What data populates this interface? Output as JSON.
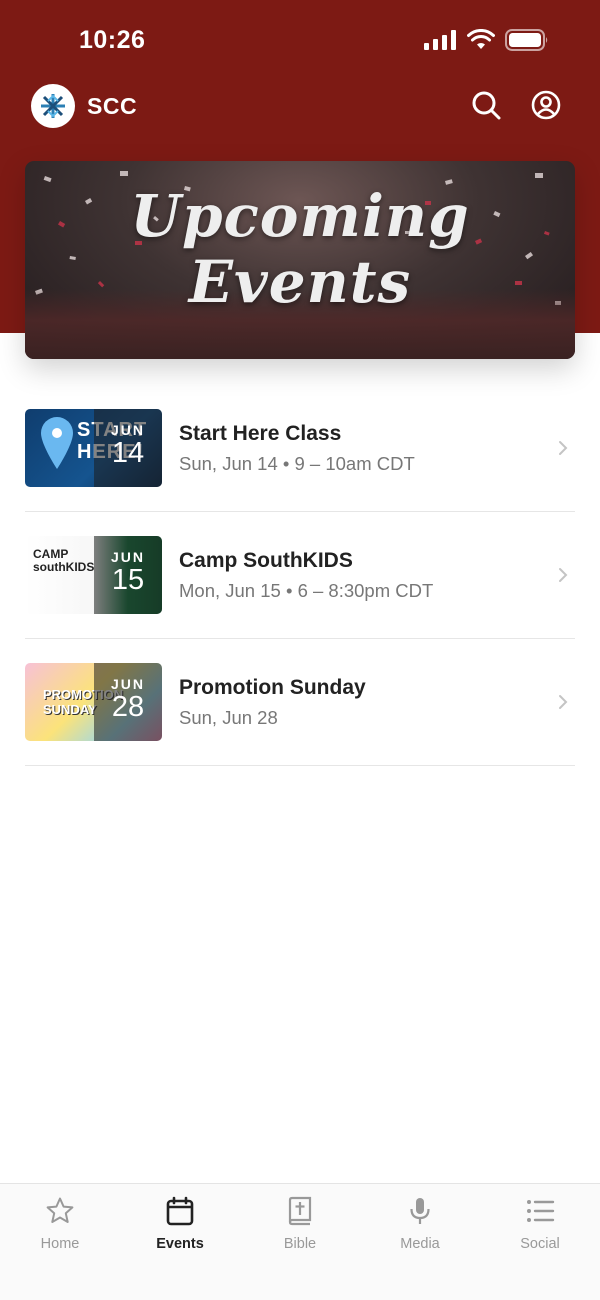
{
  "status_bar": {
    "time": "10:26"
  },
  "header": {
    "app_name": "SCC"
  },
  "banner": {
    "line1": "Upcoming",
    "line2": "Events"
  },
  "events": [
    {
      "title": "Start Here Class",
      "meta": "Sun, Jun 14 • 9 – 10am CDT",
      "month": "JUN",
      "day": "14",
      "thumb_text": "START HERE!"
    },
    {
      "title": "Camp SouthKIDS",
      "meta": "Mon, Jun 15 • 6 – 8:30pm CDT",
      "month": "JUN",
      "day": "15",
      "thumb_text": "CAMP southKIDS"
    },
    {
      "title": "Promotion Sunday",
      "meta": "Sun, Jun 28",
      "month": "JUN",
      "day": "28",
      "thumb_text": "PROMOTION SUNDAY"
    }
  ],
  "tabs": [
    {
      "label": "Home",
      "icon": "star-icon"
    },
    {
      "label": "Events",
      "icon": "calendar-icon",
      "active": true
    },
    {
      "label": "Bible",
      "icon": "bible-icon"
    },
    {
      "label": "Media",
      "icon": "microphone-icon"
    },
    {
      "label": "Social",
      "icon": "list-icon"
    }
  ],
  "colors": {
    "brand": "#7d1a14",
    "active_tab": "#222222",
    "inactive_tab": "#999999"
  }
}
